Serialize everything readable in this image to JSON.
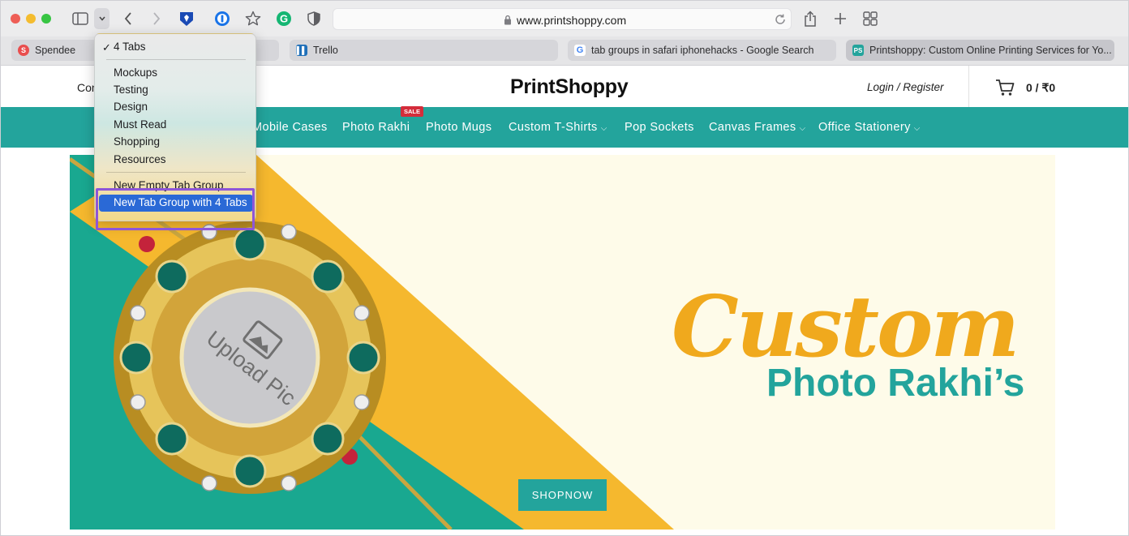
{
  "browser": {
    "url": "www.printshoppy.com",
    "tabs": [
      {
        "title": "Spendee",
        "favicon": "spendee-icon",
        "color": "#e94e4e"
      },
      {
        "title": "Trello",
        "favicon": "trello-icon",
        "color": "#1f6fb8"
      },
      {
        "title": "tab groups in safari iphonehacks - Google Search",
        "favicon": "google-icon",
        "color": "#4285f4"
      },
      {
        "title": "Printshoppy: Custom Online Printing Services for Yo...",
        "favicon": "printshoppy-icon",
        "color": "#23a49c"
      }
    ]
  },
  "tab_group_menu": {
    "current": "4 Tabs",
    "groups": [
      "Mockups",
      "Testing",
      "Design",
      "Must Read",
      "Shopping",
      "Resources"
    ],
    "new_empty": "New Empty Tab Group",
    "new_with_tabs": "New Tab Group with 4 Tabs"
  },
  "site": {
    "header_stub": "Con",
    "brand": "PrintShoppy",
    "login": "Login / Register",
    "cart": "0 / ₹0",
    "nav": [
      {
        "label": "Mobile Cases",
        "caret": ""
      },
      {
        "label": "Photo Rakhi",
        "caret": ""
      },
      {
        "label": "Photo Mugs",
        "caret": ""
      },
      {
        "label": "Custom T-Shirts",
        "caret": "⌵"
      },
      {
        "label": "Pop Sockets",
        "caret": ""
      },
      {
        "label": "Canvas Frames",
        "caret": "⌵"
      },
      {
        "label": "Office Stationery",
        "caret": "⌵"
      }
    ],
    "sale_badge": "SALE",
    "banner": {
      "headline_script": "Custom",
      "headline_sub": "Photo Rakhi’s",
      "upload_label": "Upload Pic",
      "cta": "SHOPNOW"
    }
  },
  "colors": {
    "accent": "#23a49c",
    "highlight": "#2a69d6",
    "annotation": "#8e56d8"
  }
}
